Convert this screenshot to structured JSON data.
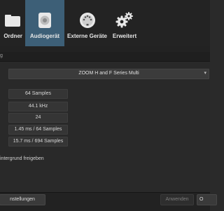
{
  "toolbar": {
    "tabs": [
      {
        "label": "Ordner",
        "icon": "folder-icon"
      },
      {
        "label": "Audiogerät",
        "icon": "speaker-icon"
      },
      {
        "label": "Externe Geräte",
        "icon": "midi-connector-icon"
      },
      {
        "label": "Erweitert",
        "icon": "gears-icon"
      }
    ],
    "active_color": "#3d5f77"
  },
  "subheader": {
    "label": "g"
  },
  "audio": {
    "device": "ZOOM H and F Series Multi",
    "buffer_size": "64 Samples",
    "sample_rate": "44.1 kHz",
    "bit_depth": "24",
    "input_latency": "1.45 ms / 64 Samples",
    "output_latency": "15.7 ms / 694 Samples"
  },
  "background_option": {
    "label": "intergrund freigeben"
  },
  "footer": {
    "left_button": "nstellungen",
    "apply_button": "Anwenden",
    "right_button": "O"
  }
}
